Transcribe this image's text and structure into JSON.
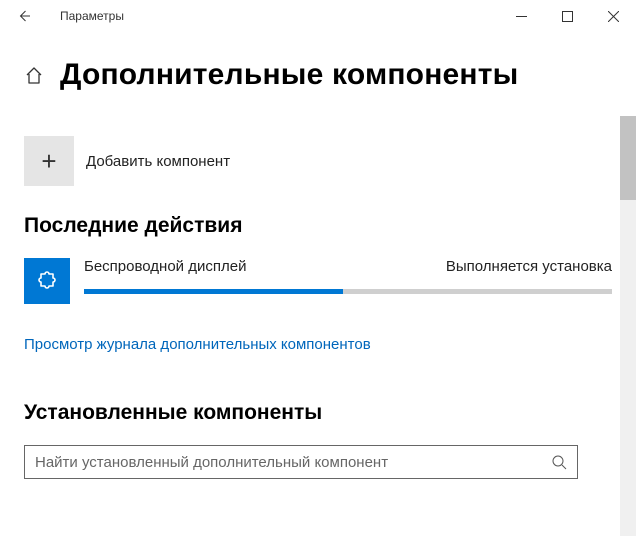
{
  "titlebar": {
    "app_name": "Параметры"
  },
  "page": {
    "title": "Дополнительные компоненты"
  },
  "add": {
    "label": "Добавить компонент"
  },
  "sections": {
    "recent_heading": "Последние действия",
    "installed_heading": "Установленные компоненты"
  },
  "recent_action": {
    "name": "Беспроводной дисплей",
    "status": "Выполняется установка",
    "progress_percent": 49
  },
  "link": {
    "history": "Просмотр журнала дополнительных компонентов"
  },
  "search": {
    "placeholder": "Найти установленный дополнительный компонент"
  }
}
